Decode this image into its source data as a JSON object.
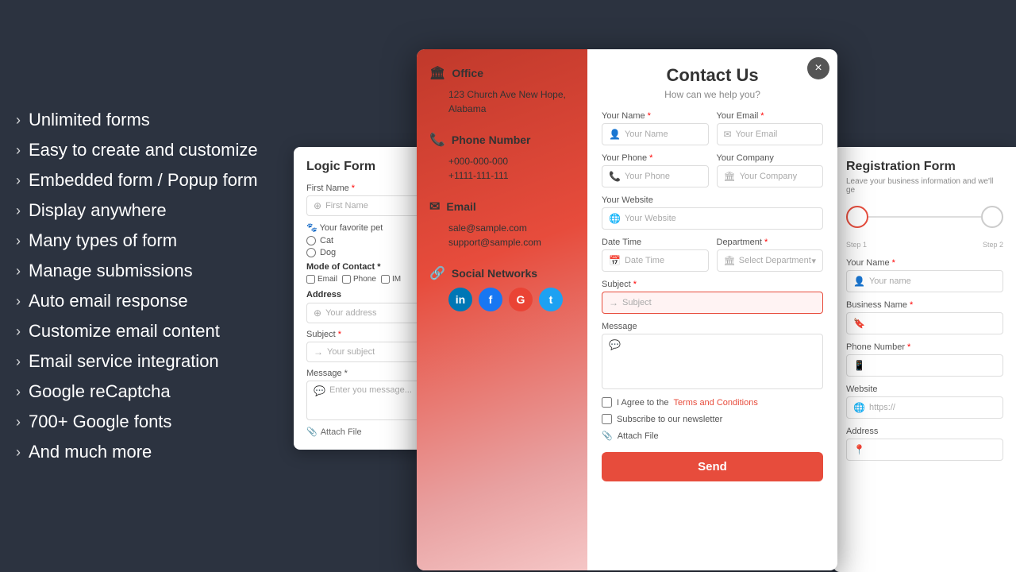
{
  "leftPanel": {
    "features": [
      {
        "id": "unlimited-forms",
        "label": "Unlimited forms"
      },
      {
        "id": "easy-create",
        "label": "Easy to create and customize"
      },
      {
        "id": "embedded-popup",
        "label": "Embedded form / Popup form"
      },
      {
        "id": "display-anywhere",
        "label": "Display anywhere"
      },
      {
        "id": "many-types",
        "label": "Many types of form"
      },
      {
        "id": "manage-submissions",
        "label": "Manage submissions"
      },
      {
        "id": "auto-email",
        "label": "Auto email response"
      },
      {
        "id": "customize-email",
        "label": "Customize email content"
      },
      {
        "id": "email-integration",
        "label": "Email service integration"
      },
      {
        "id": "recaptcha",
        "label": "Google reCaptcha"
      },
      {
        "id": "google-fonts",
        "label": "700+ Google fonts"
      },
      {
        "id": "and-more",
        "label": "And much more"
      }
    ]
  },
  "logicForm": {
    "title": "Logic Form",
    "firstNameLabel": "First Name",
    "firstNameReq": "*",
    "firstNamePlaceholder": "First Name",
    "petLabel": "Your favorite pet",
    "petOptions": [
      "Cat",
      "Dog"
    ],
    "modeLabel": "Mode of Contact",
    "modeReq": "*",
    "modeOptions": [
      "Email",
      "Phone",
      "IM"
    ],
    "addressLabel": "Address",
    "addressPlaceholder": "Your address",
    "subjectLabel": "Subject",
    "subjectReq": "*",
    "subjectPlaceholder": "Your subject",
    "messageLabel": "Message",
    "messageReq": "*",
    "messagePlaceholder": "Enter you message...",
    "attachLabel": "Attach File"
  },
  "contactModal": {
    "closeLabel": "×",
    "officeTitle": "Office",
    "officeAddress": "123 Church Ave New Hope, Alabama",
    "phoneTitle": "Phone Number",
    "phone1": "+000-000-000",
    "phone2": "+1111-111-111",
    "emailTitle": "Email",
    "email1": "sale@sample.com",
    "email2": "support@sample.com",
    "socialTitle": "Social Networks",
    "socialIcons": [
      {
        "name": "linkedin",
        "label": "in"
      },
      {
        "name": "facebook",
        "label": "f"
      },
      {
        "name": "google",
        "label": "G"
      },
      {
        "name": "twitter",
        "label": "t"
      }
    ],
    "formTitle": "Contact Us",
    "formSubtitle": "How can we help you?",
    "fields": {
      "yourNameLabel": "Your Name",
      "yourNameReq": "*",
      "yourNamePlaceholder": "Your Name",
      "yourEmailLabel": "Your Email",
      "yourEmailReq": "*",
      "yourEmailPlaceholder": "Your Email",
      "yourPhoneLabel": "Your Phone",
      "yourPhoneReq": "*",
      "yourPhonePlaceholder": "Your Phone",
      "yourCompanyLabel": "Your Company",
      "yourCompanyPlaceholder": "Your Company",
      "yourWebsiteLabel": "Your Website",
      "yourWebsitePlaceholder": "Your Website",
      "dateTimeLabel": "Date Time",
      "dateTimePlaceholder": "Date Time",
      "departmentLabel": "Department",
      "departmentReq": "*",
      "departmentPlaceholder": "Select Department",
      "subjectLabel": "Subject",
      "subjectReq": "*",
      "subjectPlaceholder": "Subject",
      "messageLabel": "Message",
      "termsText": "I Agree to the ",
      "termsLinkText": "Terms and Conditions",
      "newsletterText": "Subscribe to our newsletter",
      "attachText": "Attach File",
      "sendLabel": "Send"
    }
  },
  "registrationForm": {
    "title": "Registration Form",
    "subtitle": "Leave your business information and we'll ge",
    "step1Label": "Step 1",
    "step2Label": "Step 2",
    "yourNameLabel": "Your Name",
    "yourNameReq": "*",
    "yourNamePlaceholder": "Your name",
    "businessNameLabel": "Business Name",
    "businessNameReq": "*",
    "businessNamePlaceholder": "",
    "phoneLabel": "Phone Number",
    "phoneReq": "*",
    "phonePlaceholder": "",
    "websiteLabel": "Website",
    "websitePlaceholder": "https://",
    "addressLabel": "Address",
    "addressPlaceholder": ""
  }
}
